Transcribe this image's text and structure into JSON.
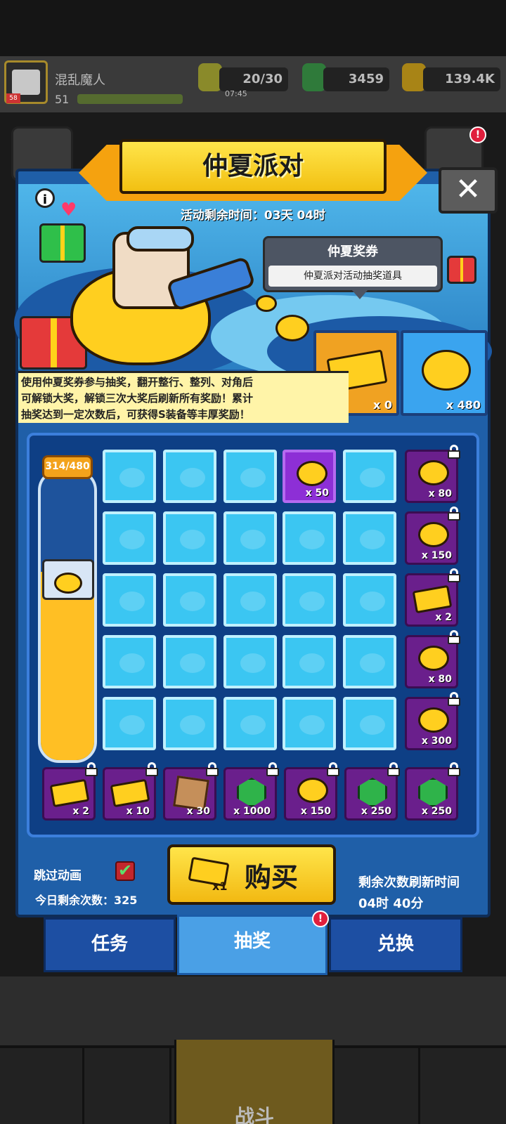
{
  "player": {
    "name": "混乱魔人",
    "level": "51",
    "avatar_level": "58"
  },
  "resources": {
    "energy": "20/30",
    "energy_timer": "07:45",
    "gems": "3459",
    "coins": "139.4K"
  },
  "event": {
    "title": "仲夏派对",
    "countdown": "活动剩余时间：03天 04时",
    "close_symbol": "✕",
    "info_symbol": "i"
  },
  "tooltip": {
    "title": "仲夏奖券",
    "description": "仲夏派对活动抽奖道具"
  },
  "inventory": {
    "ticket_count": "x 0",
    "duck_count": "x 480"
  },
  "description_lines": [
    "使用仲夏奖券参与抽奖，翻开整行、整列、对角后",
    "可解锁大奖，解锁三次大奖后刷新所有奖励！累计",
    "抽奖达到一定次数后，可获得S装备等丰厚奖励！"
  ],
  "progress": {
    "label": "314/480",
    "current": 314,
    "max": 480
  },
  "grid_top_reward": {
    "qty": "x 50"
  },
  "side_rewards": [
    {
      "type": "duck",
      "qty": "x 80"
    },
    {
      "type": "duck",
      "qty": "x 150"
    },
    {
      "type": "ticket",
      "qty": "x 2"
    },
    {
      "type": "duck",
      "qty": "x 80"
    },
    {
      "type": "duck",
      "qty": "x 300"
    }
  ],
  "bottom_rewards": [
    {
      "type": "ticket",
      "qty": "x 2"
    },
    {
      "type": "ticket",
      "qty": "x 10"
    },
    {
      "type": "map",
      "qty": "x 30"
    },
    {
      "type": "gem",
      "qty": "x 1000"
    },
    {
      "type": "duck",
      "qty": "x 150"
    },
    {
      "type": "gem",
      "qty": "x 250"
    },
    {
      "type": "gem",
      "qty": "x 250"
    }
  ],
  "controls": {
    "skip_animation": "跳过动画",
    "skip_checked": "✔",
    "remaining_today": "今日剩余次数：325",
    "buy_label": "购买",
    "buy_qty": "x1",
    "refresh_title": "剩余次数刷新时间",
    "refresh_time": "04时 40分"
  },
  "tabs": [
    {
      "label": "任务"
    },
    {
      "label": "抽奖",
      "alert": "!"
    },
    {
      "label": "兑换"
    }
  ],
  "bottom_nav": {
    "fight_label": "战斗",
    "alert": "!"
  },
  "colors": {
    "accent": "#f2c012",
    "panel": "#1f5fa8",
    "tile": "#3bc6f2",
    "reward_purple": "#6a1f8c"
  }
}
